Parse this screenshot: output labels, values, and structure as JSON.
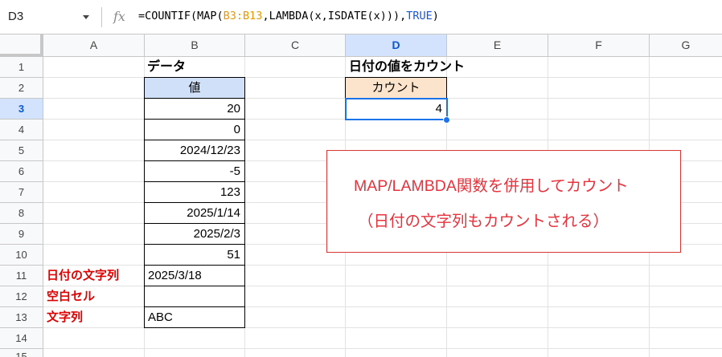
{
  "formula_bar": {
    "cell_ref": "D3",
    "fx_label": "fx",
    "formula_parts": [
      "=COUNTIF(MAP(",
      "B3:B13",
      ",LAMBDA(x,ISDATE(x))),",
      "TRUE",
      ")"
    ]
  },
  "columns": [
    "A",
    "B",
    "C",
    "D",
    "E",
    "F",
    "G"
  ],
  "selected_column": "D",
  "rows": [
    "1",
    "2",
    "3",
    "4",
    "5",
    "6",
    "7",
    "8",
    "9",
    "10",
    "11",
    "12",
    "13",
    "14",
    "15"
  ],
  "selected_row": "3",
  "sheet": {
    "b1_title": "データ",
    "b2_header": "値",
    "b_values": [
      "20",
      "0",
      "2024/12/23",
      "-5",
      "123",
      "2025/1/14",
      "2025/2/3",
      "51",
      "2025/3/18",
      "",
      "ABC"
    ],
    "a_labels": {
      "row11": "日付の文字列",
      "row12": "空白セル",
      "row13": "文字列"
    },
    "d1_title": "日付の値をカウント",
    "d2_header": "カウント",
    "d3_value": "4"
  },
  "colors": {
    "header_blue": "#cfe0f8",
    "header_orange": "#fbe3cc",
    "label_red": "#e00000",
    "note_red": "#e8323c",
    "selection_blue": "#1a73e8"
  },
  "note": {
    "line1": "MAP/LAMBDA関数を併用してカウント",
    "line2": "（日付の文字列もカウントされる）"
  }
}
